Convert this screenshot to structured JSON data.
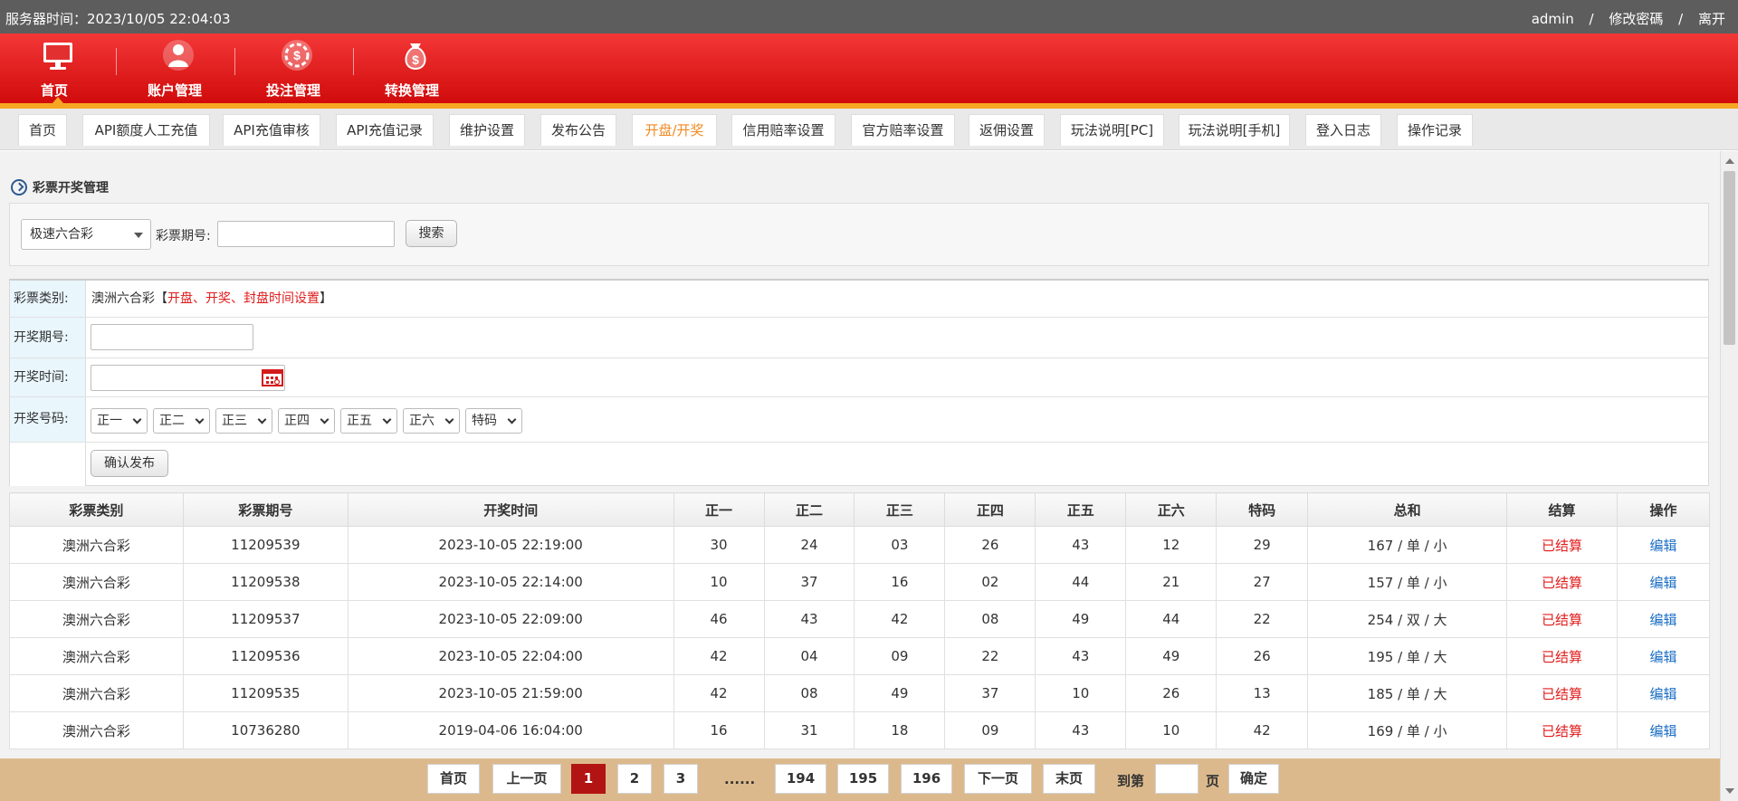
{
  "topbar": {
    "server_time": "服务器时间：2023/10/05 22:04:03",
    "user": "admin",
    "change_password": "修改密碼",
    "logout": "离开",
    "sep": "/"
  },
  "nav": {
    "items": [
      {
        "label": "首页",
        "icon": "monitor-icon",
        "active": true
      },
      {
        "label": "账户管理",
        "icon": "user-icon",
        "active": false
      },
      {
        "label": "投注管理",
        "icon": "chip-icon",
        "active": false
      },
      {
        "label": "转换管理",
        "icon": "money-bag-icon",
        "active": false
      }
    ]
  },
  "tabs": [
    {
      "label": "首页"
    },
    {
      "label": "API额度人工充值"
    },
    {
      "label": "API充值审核"
    },
    {
      "label": "API充值记录"
    },
    {
      "label": "维护设置"
    },
    {
      "label": "发布公告"
    },
    {
      "label": "开盘/开奖",
      "active": true
    },
    {
      "label": "信用赔率设置"
    },
    {
      "label": "官方赔率设置"
    },
    {
      "label": "返佣设置"
    },
    {
      "label": "玩法说明[PC]"
    },
    {
      "label": "玩法说明[手机]"
    },
    {
      "label": "登入日志"
    },
    {
      "label": "操作记录"
    }
  ],
  "section": {
    "title": "彩票开奖管理"
  },
  "search": {
    "lottery_type": "极速六合彩",
    "period_label": "彩票期号:",
    "period_value": "",
    "search_button": "搜索"
  },
  "form": {
    "type_label": "彩票类别:",
    "type_value": "澳洲六合彩",
    "type_link_open": "【",
    "type_link": "开盘、开奖、封盘时间设置",
    "type_link_close": "】",
    "period_label": "开奖期号:",
    "time_label": "开奖时间:",
    "numbers_label": "开奖号码:",
    "number_selects": [
      "正一",
      "正二",
      "正三",
      "正四",
      "正五",
      "正六",
      "特码"
    ],
    "confirm_button": "确认发布"
  },
  "table": {
    "headers": [
      "彩票类别",
      "彩票期号",
      "开奖时间",
      "正一",
      "正二",
      "正三",
      "正四",
      "正五",
      "正六",
      "特码",
      "总和",
      "结算",
      "操作"
    ],
    "rows": [
      [
        "澳洲六合彩",
        "11209539",
        "2023-10-05 22:19:00",
        "30",
        "24",
        "03",
        "26",
        "43",
        "12",
        "29",
        "167 / 单 / 小",
        "已结算",
        "编辑"
      ],
      [
        "澳洲六合彩",
        "11209538",
        "2023-10-05 22:14:00",
        "10",
        "37",
        "16",
        "02",
        "44",
        "21",
        "27",
        "157 / 单 / 小",
        "已结算",
        "编辑"
      ],
      [
        "澳洲六合彩",
        "11209537",
        "2023-10-05 22:09:00",
        "46",
        "43",
        "42",
        "08",
        "49",
        "44",
        "22",
        "254 / 双 / 大",
        "已结算",
        "编辑"
      ],
      [
        "澳洲六合彩",
        "11209536",
        "2023-10-05 22:04:00",
        "42",
        "04",
        "09",
        "22",
        "43",
        "49",
        "26",
        "195 / 单 / 大",
        "已结算",
        "编辑"
      ],
      [
        "澳洲六合彩",
        "11209535",
        "2023-10-05 21:59:00",
        "42",
        "08",
        "49",
        "37",
        "10",
        "26",
        "13",
        "185 / 单 / 大",
        "已结算",
        "编辑"
      ],
      [
        "澳洲六合彩",
        "10736280",
        "2019-04-06 16:04:00",
        "16",
        "31",
        "18",
        "09",
        "43",
        "10",
        "42",
        "169 / 单 / 小",
        "已结算",
        "编辑"
      ]
    ]
  },
  "pager": {
    "first": "首页",
    "prev": "上一页",
    "pages": [
      "1",
      "2",
      "3"
    ],
    "ellipsis": "......",
    "tail_pages": [
      "194",
      "195",
      "196"
    ],
    "next": "下一页",
    "last": "末页",
    "goto_label": "到第",
    "page_unit": "页",
    "confirm": "确定",
    "current": "1"
  },
  "colors": {
    "header_red": "#e11f1f",
    "accent_orange": "#f08a24",
    "settled_red": "#e01c1c",
    "link_blue": "#1a6dc4",
    "pager_bg": "#dcb98c"
  }
}
